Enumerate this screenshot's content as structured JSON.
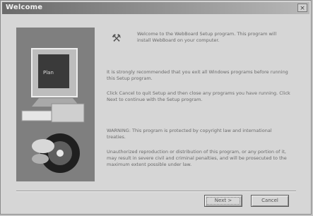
{
  "window": {
    "title": "Welcome",
    "close_glyph": "×"
  },
  "icon": {
    "welcome": "wrench-icon"
  },
  "text": {
    "intro": "Welcome to the WebBoard Setup program. This program will install WebBoard on your computer.",
    "recommend": "It is strongly recommended that you exit all Windows programs before running this Setup program.",
    "instructions": "Click Cancel to quit Setup and then close any programs you have running. Click Next to continue with the Setup program.",
    "warning": "WARNING: This program is protected by copyright law and international treaties.",
    "penalties": "Unauthorized reproduction or distribution of this program, or any portion of it, may result in severe civil and criminal penalties, and will be prosecuted to the maximum extent possible under law."
  },
  "buttons": {
    "next": "Next >",
    "cancel": "Cancel"
  },
  "art": {
    "monitor_text": "Plan"
  }
}
